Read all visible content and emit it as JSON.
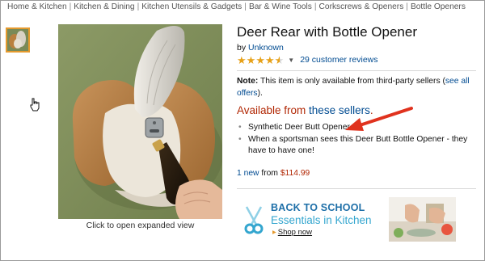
{
  "breadcrumb": [
    "Home & Kitchen",
    "Kitchen & Dining",
    "Kitchen Utensils & Gadgets",
    "Bar & Wine Tools",
    "Corkscrews & Openers",
    "Bottle Openers"
  ],
  "breadcrumb_separator": "|",
  "image_caption": "Click to open expanded view",
  "product": {
    "title": "Deer Rear with Bottle Opener",
    "by_prefix": "by",
    "brand": "Unknown",
    "rating": 4.5,
    "rating_max": 5,
    "reviews_link": "29 customer reviews",
    "note_label": "Note:",
    "note_text": " This item is only available from third-party sellers (",
    "note_link": "see all offers",
    "note_suffix": ").",
    "available_prefix": "Available from ",
    "available_link": "these sellers",
    "available_suffix": ".",
    "bullets": [
      "Synthetic Deer Butt Opener",
      "When a sportsman sees this Deer Butt Bottle Opener - they have to have one!"
    ],
    "offers_new": "1 new",
    "offers_from": " from ",
    "offers_price": "$114.99"
  },
  "banner": {
    "title": "BACK TO SCHOOL",
    "subtitle": "Essentials in Kitchen",
    "link": "Shop now"
  },
  "colors": {
    "link": "#004b91",
    "price": "#b12704",
    "star": "#e7a118",
    "arrow": "#e0321e",
    "banner_title": "#1e6fa8",
    "banner_sub": "#34a6cf"
  }
}
